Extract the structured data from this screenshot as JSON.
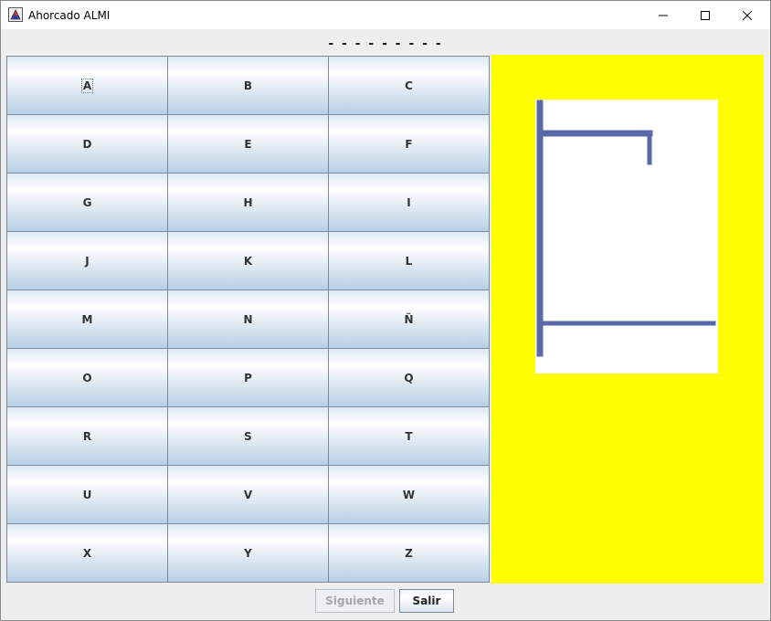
{
  "window": {
    "title": "Ahorcado ALMI",
    "controls": {
      "minimize_icon": "minimize-icon",
      "maximize_icon": "maximize-icon",
      "close_icon": "close-icon"
    }
  },
  "word": {
    "display": "- - - - - - - - -"
  },
  "keyboard": {
    "keys": [
      "A",
      "B",
      "C",
      "D",
      "E",
      "F",
      "G",
      "H",
      "I",
      "J",
      "K",
      "L",
      "M",
      "N",
      "Ñ",
      "O",
      "P",
      "Q",
      "R",
      "S",
      "T",
      "U",
      "V",
      "W",
      "X",
      "Y",
      "Z"
    ],
    "focused_key": "A"
  },
  "hangman": {
    "panel_color": "#ffff00",
    "stroke_color": "#5868a8"
  },
  "buttons": {
    "next_label": "Siguiente",
    "next_enabled": false,
    "exit_label": "Salir"
  }
}
